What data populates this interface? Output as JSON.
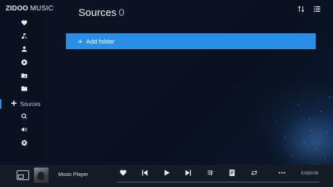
{
  "app": {
    "brand_bold": "ZIDOO",
    "brand_light": " MUSIC"
  },
  "sidebar": {
    "items": [
      {
        "name": "favorites",
        "icon": "heart-icon"
      },
      {
        "name": "songs",
        "icon": "music-note-icon"
      },
      {
        "name": "artists",
        "icon": "person-icon"
      },
      {
        "name": "albums",
        "icon": "disc-icon"
      },
      {
        "name": "folders",
        "icon": "folder-music-icon"
      },
      {
        "name": "local",
        "icon": "folder-icon"
      },
      {
        "name": "sources",
        "icon": "plus-icon",
        "label": "Sources",
        "active": true
      },
      {
        "name": "search",
        "icon": "search-icon"
      },
      {
        "name": "dlna",
        "icon": "cast-icon"
      },
      {
        "name": "settings",
        "icon": "gear-icon"
      }
    ]
  },
  "header": {
    "title": "Sources",
    "count": "0",
    "sort_icon": "sort-icon",
    "list_icon": "list-view-icon"
  },
  "main": {
    "add_folder_label": "Add folder",
    "add_folder_icon": "+"
  },
  "player": {
    "track_title": "Music Player",
    "time": "0:00/0:00",
    "progress": 0
  },
  "colors": {
    "accent": "#2a8fe6",
    "background": "#0c1422",
    "player_bg": "#141c28"
  }
}
